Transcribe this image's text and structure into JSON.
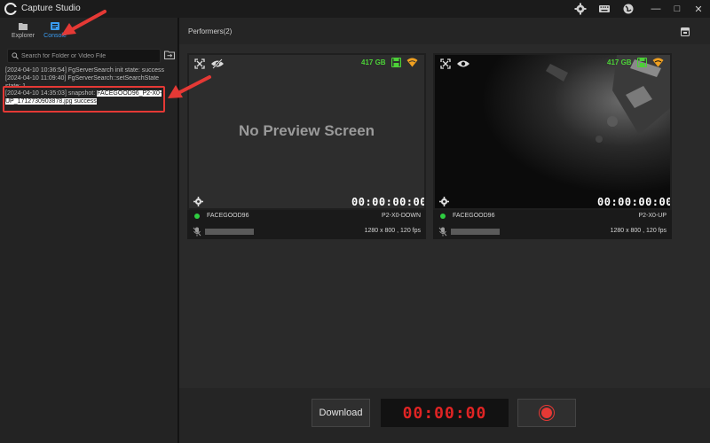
{
  "app": {
    "title": "Capture Studio",
    "accent_color": "#3a9bf0"
  },
  "titlebar_icons": [
    "gear-icon",
    "keyboard-icon",
    "globe-icon"
  ],
  "window_controls": {
    "minimize": "—",
    "maximize": "□",
    "close": "✕"
  },
  "sidebar": {
    "tabs": [
      {
        "label": "Explorer",
        "icon": "folder-icon",
        "active": false
      },
      {
        "label": "Console",
        "icon": "console-icon",
        "active": true
      }
    ],
    "search": {
      "placeholder": "Search for Folder or Video File",
      "value": ""
    },
    "logs": [
      {
        "text": "[2024-04-10 10:36:54] FgServerSearch init state: success"
      },
      {
        "text": "[2024-04-10 11:09:40] FgServerSearch::setSearchState state: 1"
      },
      {
        "prefix": "[2024-04-10 14:35:03] snapshot: ",
        "highlight": "FACEGOOD96_P2-X0-UP_1712730903878.jpg success"
      }
    ]
  },
  "main": {
    "title": "Performers(2)",
    "performers": [
      {
        "storage": "417 GB",
        "preview_text": "No Preview Screen",
        "timecode": "00:00:00:00",
        "name": "FACEGOOD96",
        "device": "P2-X0-DOWN",
        "resolution": "1280 x 800 , 120 fps",
        "status_color": "#2ecc40",
        "preview_visible": false
      },
      {
        "storage": "417 GB",
        "preview_text": "",
        "timecode": "00:00:00:00",
        "name": "FACEGOOD96",
        "device": "P2-X0-UP",
        "resolution": "1280 x 800 , 120 fps",
        "status_color": "#2ecc40",
        "preview_visible": true
      }
    ]
  },
  "bottom": {
    "download_label": "Download",
    "record_timer": "00:00:00",
    "record_color": "#e53935"
  },
  "annotation_color": "#e53935"
}
